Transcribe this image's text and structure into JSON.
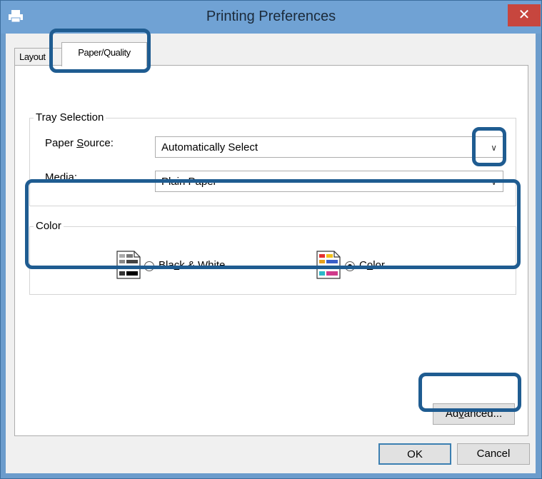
{
  "window": {
    "title": "Printing Preferences",
    "close_label": "✕",
    "icon": "printer-icon"
  },
  "tabs": [
    {
      "label": "Layout",
      "selected": false
    },
    {
      "label": "Paper/Quality",
      "selected": true
    }
  ],
  "tray_selection": {
    "title": "Tray Selection",
    "paper_source": {
      "label_pre": "Paper ",
      "label_u": "S",
      "label_post": "ource:",
      "value": "Automatically Select"
    },
    "media": {
      "label_pre": "",
      "label_u": "M",
      "label_post": "edia:",
      "value": "Plain Paper"
    }
  },
  "color_group": {
    "title": "Color",
    "options": [
      {
        "label_pre": "Bla",
        "label_u": "c",
        "label_post": "k & White",
        "selected": false,
        "icon": "grayscale-page-icon"
      },
      {
        "label_pre": "C",
        "label_u": "o",
        "label_post": "lor",
        "selected": true,
        "icon": "color-page-icon"
      }
    ]
  },
  "buttons": {
    "advanced": {
      "pre": "Ad",
      "u": "v",
      "post": "anced..."
    },
    "ok": "OK",
    "cancel": "Cancel"
  },
  "colors": {
    "titlebar": "#70a2d4",
    "highlight": "#1f5c91",
    "close": "#c7463e"
  }
}
